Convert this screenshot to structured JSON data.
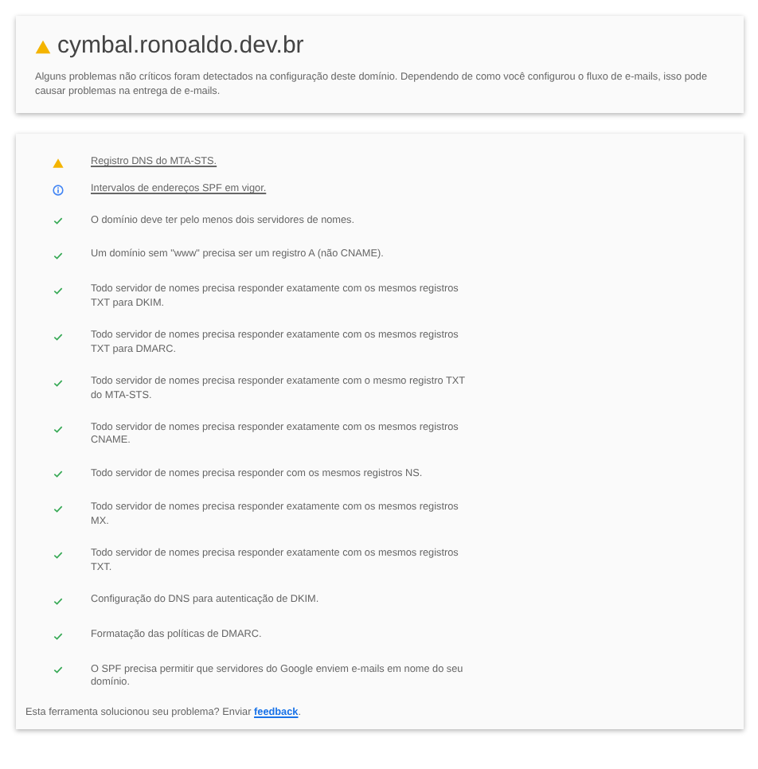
{
  "header": {
    "kind": "warning",
    "title": "cymbal.ronoaldo.dev.br",
    "description": "Alguns problemas não críticos foram detectados na configuração deste domínio. Dependendo de como você configurou o fluxo de e-mails, isso pode causar problemas na entrega de e-mails."
  },
  "checks": [
    {
      "kind": "warning",
      "text": "Registro DNS do MTA-STS.",
      "link": true
    },
    {
      "kind": "info",
      "text": "Intervalos de endereços SPF em vigor.",
      "link": true
    },
    {
      "kind": "ok",
      "text": "O domínio deve ter pelo menos dois servidores de nomes.",
      "link": false
    },
    {
      "kind": "ok",
      "text": "Um domínio sem \"www\" precisa ser um registro A (não CNAME).",
      "link": false
    },
    {
      "kind": "ok",
      "text": "Todo servidor de nomes precisa responder exatamente com os mesmos registros TXT para DKIM.",
      "link": false
    },
    {
      "kind": "ok",
      "text": "Todo servidor de nomes precisa responder exatamente com os mesmos registros TXT para DMARC.",
      "link": false
    },
    {
      "kind": "ok",
      "text": "Todo servidor de nomes precisa responder exatamente com o mesmo registro TXT do MTA-STS.",
      "link": false
    },
    {
      "kind": "ok",
      "text": "Todo servidor de nomes precisa responder exatamente com os mesmos registros CNAME.",
      "link": false
    },
    {
      "kind": "ok",
      "text": "Todo servidor de nomes precisa responder com os mesmos registros NS.",
      "link": false
    },
    {
      "kind": "ok",
      "text": "Todo servidor de nomes precisa responder exatamente com os mesmos registros MX.",
      "link": false
    },
    {
      "kind": "ok",
      "text": "Todo servidor de nomes precisa responder exatamente com os mesmos registros TXT.",
      "link": false
    },
    {
      "kind": "ok",
      "text": "Configuração do DNS para autenticação de DKIM.",
      "link": false
    },
    {
      "kind": "ok",
      "text": "Formatação das políticas de DMARC.",
      "link": false
    },
    {
      "kind": "ok",
      "text": "O SPF precisa permitir que servidores do Google enviem e-mails em nome do seu domínio.",
      "link": false
    }
  ],
  "footer": {
    "text": "Esta ferramenta solucionou seu problema? Enviar",
    "link": "feedback",
    "end": "."
  }
}
